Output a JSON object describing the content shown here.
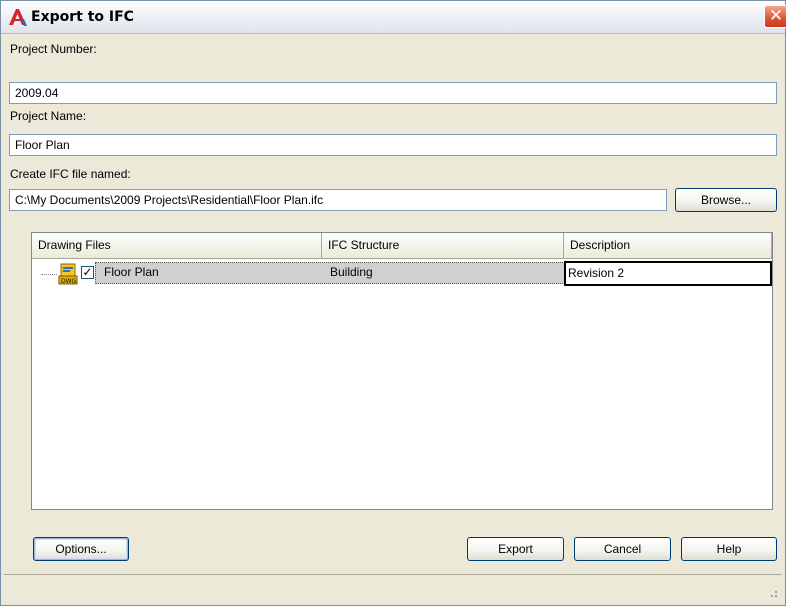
{
  "window": {
    "title": "Export to IFC",
    "close_glyph": "✕",
    "app_icon": "autocad-a-icon"
  },
  "project_number": {
    "label": "Project Number:",
    "value": "2009.04"
  },
  "project_name": {
    "label": "Project Name:",
    "value": "Floor Plan"
  },
  "ifc_file": {
    "label": "Create IFC file named:",
    "value": "C:\\My Documents\\2009 Projects\\Residential\\Floor Plan.ifc",
    "browse_label": "Browse..."
  },
  "table": {
    "columns": [
      "Drawing Files",
      "IFC Structure",
      "Description"
    ],
    "rows": [
      {
        "file": "Floor Plan",
        "checked": true,
        "check_glyph": "✓",
        "structure": "Building",
        "description": "Revision 2",
        "icon": "dwg-file-icon"
      }
    ]
  },
  "buttons": {
    "options": "Options...",
    "export": "Export",
    "cancel": "Cancel",
    "help": "Help"
  },
  "colors": {
    "dialog_bg": "#ece9d8",
    "selection": "#d0d0d0",
    "close_red": "#e2563a",
    "border_blue": "#7f9db9"
  }
}
